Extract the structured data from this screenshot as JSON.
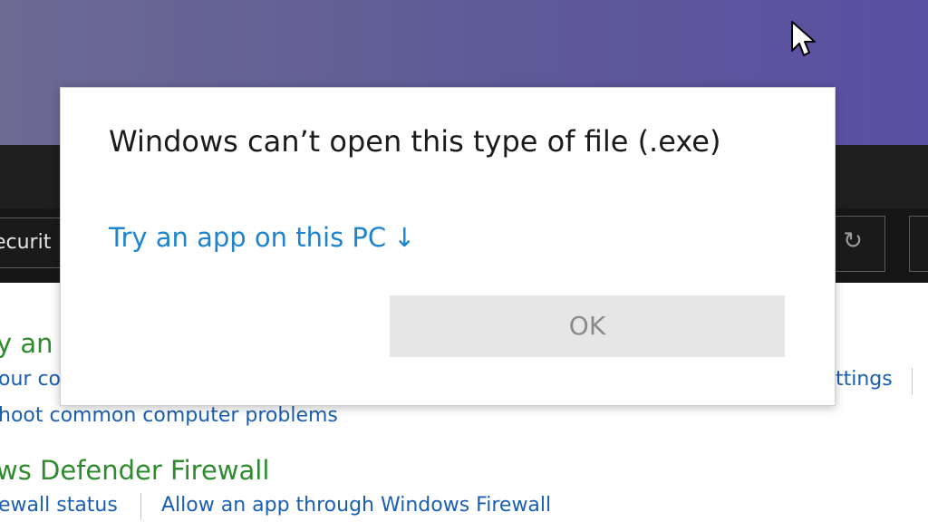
{
  "background": {
    "breadcrumb_text": "Securit",
    "section1": {
      "heading": "y an",
      "link1": "our co",
      "link2": "hoot common computer problems",
      "link_right": "ttings"
    },
    "section2": {
      "heading": "ws Defender Firewall",
      "link1": "ewall status",
      "link2": "Allow an app through Windows Firewall"
    },
    "colors": {
      "heading": "#2e8b2e",
      "link": "#1a5fb4",
      "wallpaper": "#5e5a98"
    }
  },
  "dialog": {
    "title": "Windows can’t open this type of file (.exe)",
    "link_label": "Try an app on this PC",
    "link_icon": "arrow-down-icon",
    "link_arrow": "↓",
    "ok_label": "OK",
    "colors": {
      "link": "#1f84d0",
      "button_bg": "#e6e6e6"
    }
  },
  "refresh_icon_glyph": "↻"
}
